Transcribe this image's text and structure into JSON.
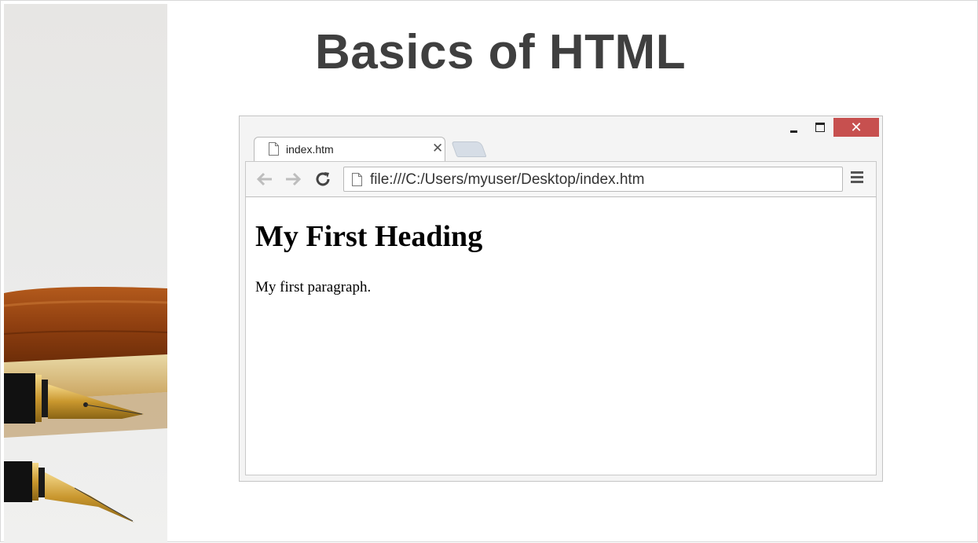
{
  "slide": {
    "title": "Basics of HTML"
  },
  "browser": {
    "tab": {
      "label": "index.htm",
      "close_glyph": "✕"
    },
    "window_controls": {
      "close_glyph": "✕"
    },
    "address_bar": {
      "value": "file:///C:/Users/myuser/Desktop/index.htm"
    },
    "page": {
      "heading": "My First Heading",
      "paragraph": "My first paragraph."
    }
  },
  "colors": {
    "title_text": "#3f3f3f",
    "close_button": "#c7504f",
    "new_tab": "#d6dde6"
  },
  "icons": [
    "file-icon",
    "back-arrow-icon",
    "forward-arrow-icon",
    "reload-icon",
    "hamburger-menu-icon",
    "minimize-icon",
    "maximize-icon",
    "close-icon"
  ]
}
